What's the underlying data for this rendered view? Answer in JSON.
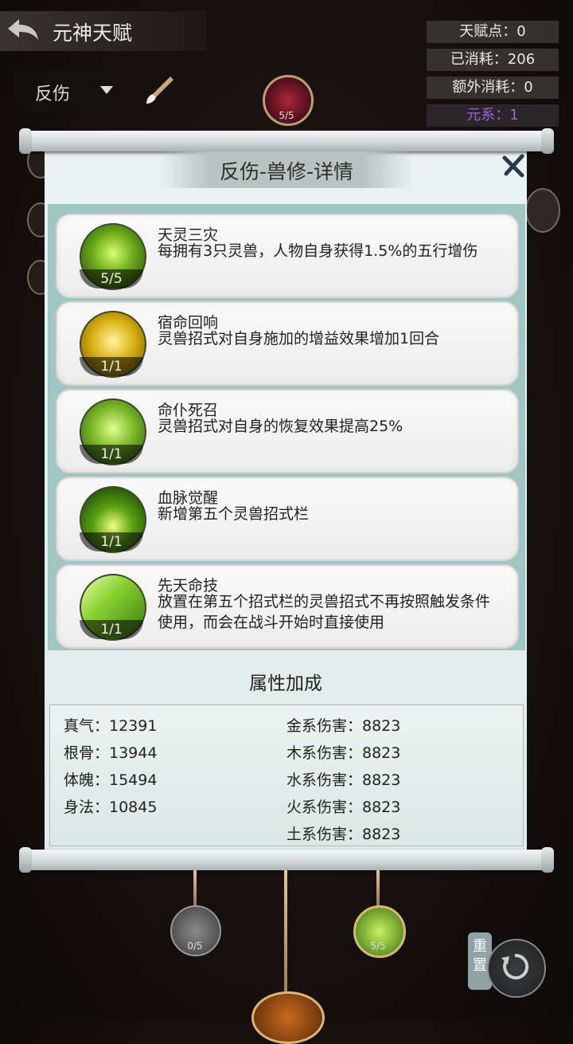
{
  "header": {
    "title": "元神天赋",
    "filter_label": "反伤"
  },
  "stats": {
    "talent_points": "天赋点：0",
    "consumed": "已消耗：206",
    "extra_consumed": "额外消耗：0",
    "element": "元系：1"
  },
  "top_node": {
    "count": "5/5"
  },
  "dialog": {
    "title": "反伤-兽修-详情",
    "skills": [
      {
        "name": "天灵三灾",
        "desc": "每拥有3只灵兽，人物自身获得1.5%的五行增伤",
        "count": "5/5",
        "icon": "green-beast-icon"
      },
      {
        "name": "宿命回响",
        "desc": "灵兽招式对自身施加的增益效果增加1回合",
        "count": "1/1",
        "icon": "golden-rings-icon"
      },
      {
        "name": "命仆死召",
        "desc": "灵兽招式对自身的恢复效果提高25%",
        "count": "1/1",
        "icon": "green-heal-icon"
      },
      {
        "name": "血脉觉醒",
        "desc": "新增第五个灵兽招式栏",
        "count": "1/1",
        "icon": "green-flame-icon"
      },
      {
        "name": "先天命技",
        "desc": "放置在第五个招式栏的灵兽招式不再按照触发条件使用，而会在战斗开始时直接使用",
        "count": "1/1",
        "icon": "green-leaf-icon"
      }
    ],
    "attr_title": "属性加成",
    "attrs_left": [
      "真气：12391",
      "根骨：13944",
      "体魄：15494",
      "身法：10845"
    ],
    "attrs_right": [
      "金系伤害：8823",
      "木系伤害：8823",
      "水系伤害：8823",
      "火系伤害：8823",
      "土系伤害：8823"
    ]
  },
  "bottom": {
    "left_node_count": "0/5",
    "right_node_count": "5/5",
    "reset_label": "重置"
  },
  "colors": {
    "accent_teal": "#9ec6c2",
    "element_purple": "#a060d0",
    "gold": "#e2c68a"
  }
}
